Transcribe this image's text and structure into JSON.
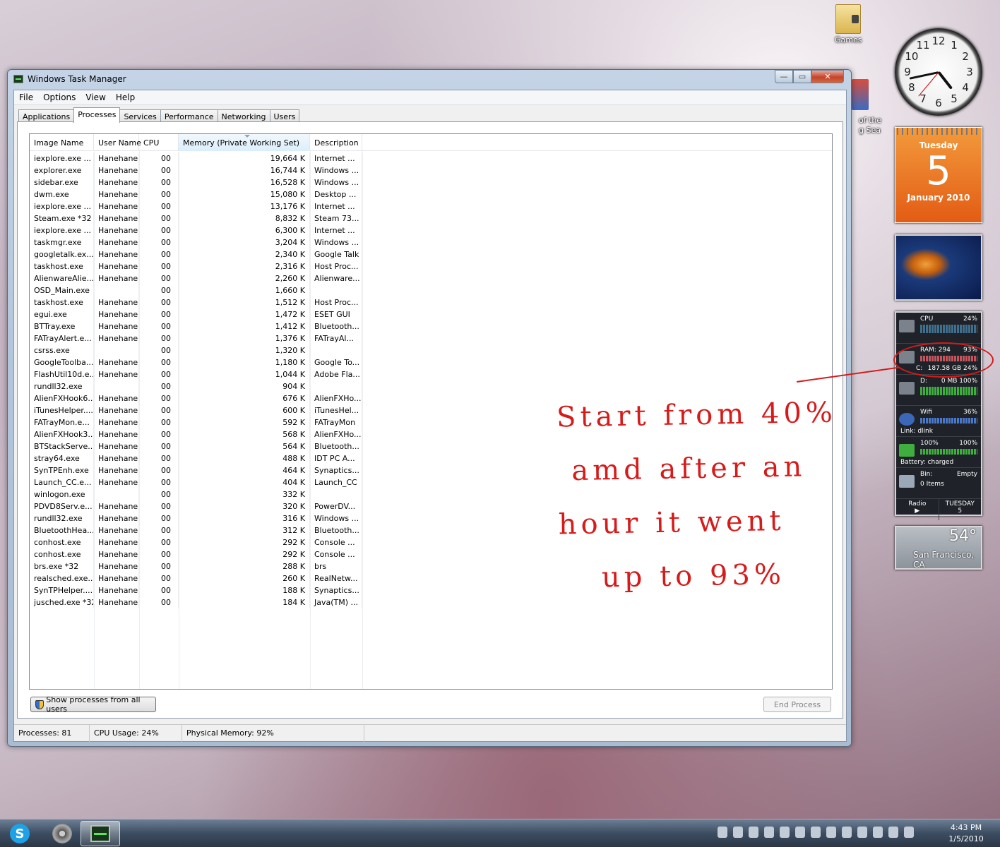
{
  "desktop": {
    "icons": [
      {
        "label": "Games"
      },
      {
        "label": "of the\ng Sea"
      }
    ]
  },
  "window": {
    "title": "Windows Task Manager",
    "controls": {
      "minimize": "—",
      "maximize": "▭",
      "close": "✕"
    },
    "menu": [
      "File",
      "Options",
      "View",
      "Help"
    ],
    "tabs": [
      "Applications",
      "Processes",
      "Services",
      "Performance",
      "Networking",
      "Users"
    ],
    "active_tab": "Processes",
    "columns": [
      "Image Name",
      "User Name",
      "CPU",
      "Memory (Private Working Set)",
      "Description"
    ],
    "processes": [
      [
        "iexplore.exe ...",
        "Hanehane",
        "00",
        "19,664 K",
        "Internet ..."
      ],
      [
        "explorer.exe",
        "Hanehane",
        "00",
        "16,744 K",
        "Windows ..."
      ],
      [
        "sidebar.exe",
        "Hanehane",
        "00",
        "16,528 K",
        "Windows ..."
      ],
      [
        "dwm.exe",
        "Hanehane",
        "00",
        "15,080 K",
        "Desktop ..."
      ],
      [
        "iexplore.exe ...",
        "Hanehane",
        "00",
        "13,176 K",
        "Internet ..."
      ],
      [
        "Steam.exe *32",
        "Hanehane",
        "00",
        "8,832 K",
        "Steam 73..."
      ],
      [
        "iexplore.exe ...",
        "Hanehane",
        "00",
        "6,300 K",
        "Internet ..."
      ],
      [
        "taskmgr.exe",
        "Hanehane",
        "00",
        "3,204 K",
        "Windows ..."
      ],
      [
        "googletalk.ex...",
        "Hanehane",
        "00",
        "2,340 K",
        "Google Talk"
      ],
      [
        "taskhost.exe",
        "Hanehane",
        "00",
        "2,316 K",
        "Host Proc..."
      ],
      [
        "AlienwareAlie...",
        "Hanehane",
        "00",
        "2,260 K",
        "Alienware..."
      ],
      [
        "OSD_Main.exe",
        "",
        "00",
        "1,660 K",
        ""
      ],
      [
        "taskhost.exe",
        "Hanehane",
        "00",
        "1,512 K",
        "Host Proc..."
      ],
      [
        "egui.exe",
        "Hanehane",
        "00",
        "1,472 K",
        "ESET GUI"
      ],
      [
        "BTTray.exe",
        "Hanehane",
        "00",
        "1,412 K",
        "Bluetooth..."
      ],
      [
        "FATrayAlert.e...",
        "Hanehane",
        "00",
        "1,376 K",
        "FATrayAl..."
      ],
      [
        "csrss.exe",
        "",
        "00",
        "1,320 K",
        ""
      ],
      [
        "GoogleToolba...",
        "Hanehane",
        "00",
        "1,180 K",
        "Google To..."
      ],
      [
        "FlashUtil10d.e...",
        "Hanehane",
        "00",
        "1,044 K",
        "Adobe Fla..."
      ],
      [
        "rundll32.exe",
        "",
        "00",
        "904 K",
        ""
      ],
      [
        "AlienFXHook6...",
        "Hanehane",
        "00",
        "676 K",
        "AlienFXHo..."
      ],
      [
        "iTunesHelper....",
        "Hanehane",
        "00",
        "600 K",
        "iTunesHel..."
      ],
      [
        "FATrayMon.e...",
        "Hanehane",
        "00",
        "592 K",
        "FATrayMon"
      ],
      [
        "AlienFXHook3...",
        "Hanehane",
        "00",
        "568 K",
        "AlienFXHo..."
      ],
      [
        "BTStackServe...",
        "Hanehane",
        "00",
        "564 K",
        "Bluetooth..."
      ],
      [
        "stray64.exe",
        "Hanehane",
        "00",
        "488 K",
        "IDT PC A..."
      ],
      [
        "SynTPEnh.exe",
        "Hanehane",
        "00",
        "464 K",
        "Synaptics..."
      ],
      [
        "Launch_CC.e...",
        "Hanehane",
        "00",
        "404 K",
        "Launch_CC"
      ],
      [
        "winlogon.exe",
        "",
        "00",
        "332 K",
        ""
      ],
      [
        "PDVD8Serv.e...",
        "Hanehane",
        "00",
        "320 K",
        "PowerDV..."
      ],
      [
        "rundll32.exe",
        "Hanehane",
        "00",
        "316 K",
        "Windows ..."
      ],
      [
        "BluetoothHea...",
        "Hanehane",
        "00",
        "312 K",
        "Bluetooth..."
      ],
      [
        "conhost.exe",
        "Hanehane",
        "00",
        "292 K",
        "Console ..."
      ],
      [
        "conhost.exe",
        "Hanehane",
        "00",
        "292 K",
        "Console ..."
      ],
      [
        "brs.exe *32",
        "Hanehane",
        "00",
        "288 K",
        "brs"
      ],
      [
        "realsched.exe...",
        "Hanehane",
        "00",
        "260 K",
        "RealNetw..."
      ],
      [
        "SynTPHelper....",
        "Hanehane",
        "00",
        "188 K",
        "Synaptics..."
      ],
      [
        "jusched.exe *32",
        "Hanehane",
        "00",
        "184 K",
        "Java(TM) ..."
      ]
    ],
    "show_all_label": "Show processes from all users",
    "end_process_label": "End Process",
    "status": {
      "processes": "Processes: 81",
      "cpu": "CPU Usage: 24%",
      "memory": "Physical Memory: 92%"
    }
  },
  "gadgets": {
    "clock_numbers": [
      "12",
      "1",
      "2",
      "3",
      "4",
      "5",
      "6",
      "7",
      "8",
      "9",
      "10",
      "11"
    ],
    "calendar": {
      "weekday": "Tuesday",
      "day": "5",
      "month": "January 2010"
    },
    "sysmon": {
      "cpu": {
        "label": "CPU",
        "value": "24%"
      },
      "ram": {
        "label": "RAM: 294",
        "value": "93%"
      },
      "c_drive": {
        "label": "C:",
        "value": "187.58 GB 24%"
      },
      "d_drive": {
        "label": "D:",
        "value": "0 MB 100%"
      },
      "wifi": {
        "label": "Wifi",
        "value": "36%",
        "sub": "Link: dlink"
      },
      "battery": {
        "label": "100%",
        "value": "100%",
        "sub": "Battery: charged"
      },
      "bin": {
        "label": "Bin:",
        "value": "Empty",
        "sub": "0 Items"
      },
      "bottom_left": {
        "line1": "Radio",
        "line2": "▶"
      },
      "bottom_right": {
        "line1": "TUESDAY",
        "line2": "5"
      }
    },
    "weather": {
      "temp": "54°",
      "city": "San Francisco, CA"
    }
  },
  "annotation": {
    "lines": [
      "Start from 40%",
      "amd after an",
      "hour it went",
      "up to 93%"
    ]
  },
  "taskbar": {
    "time": "4:43 PM",
    "date": "1/5/2010",
    "skype_glyph": "S"
  },
  "colors": {
    "annotation": "#d61b1b",
    "calendar": "#e25c14",
    "titlebar": "#b3c6db"
  }
}
